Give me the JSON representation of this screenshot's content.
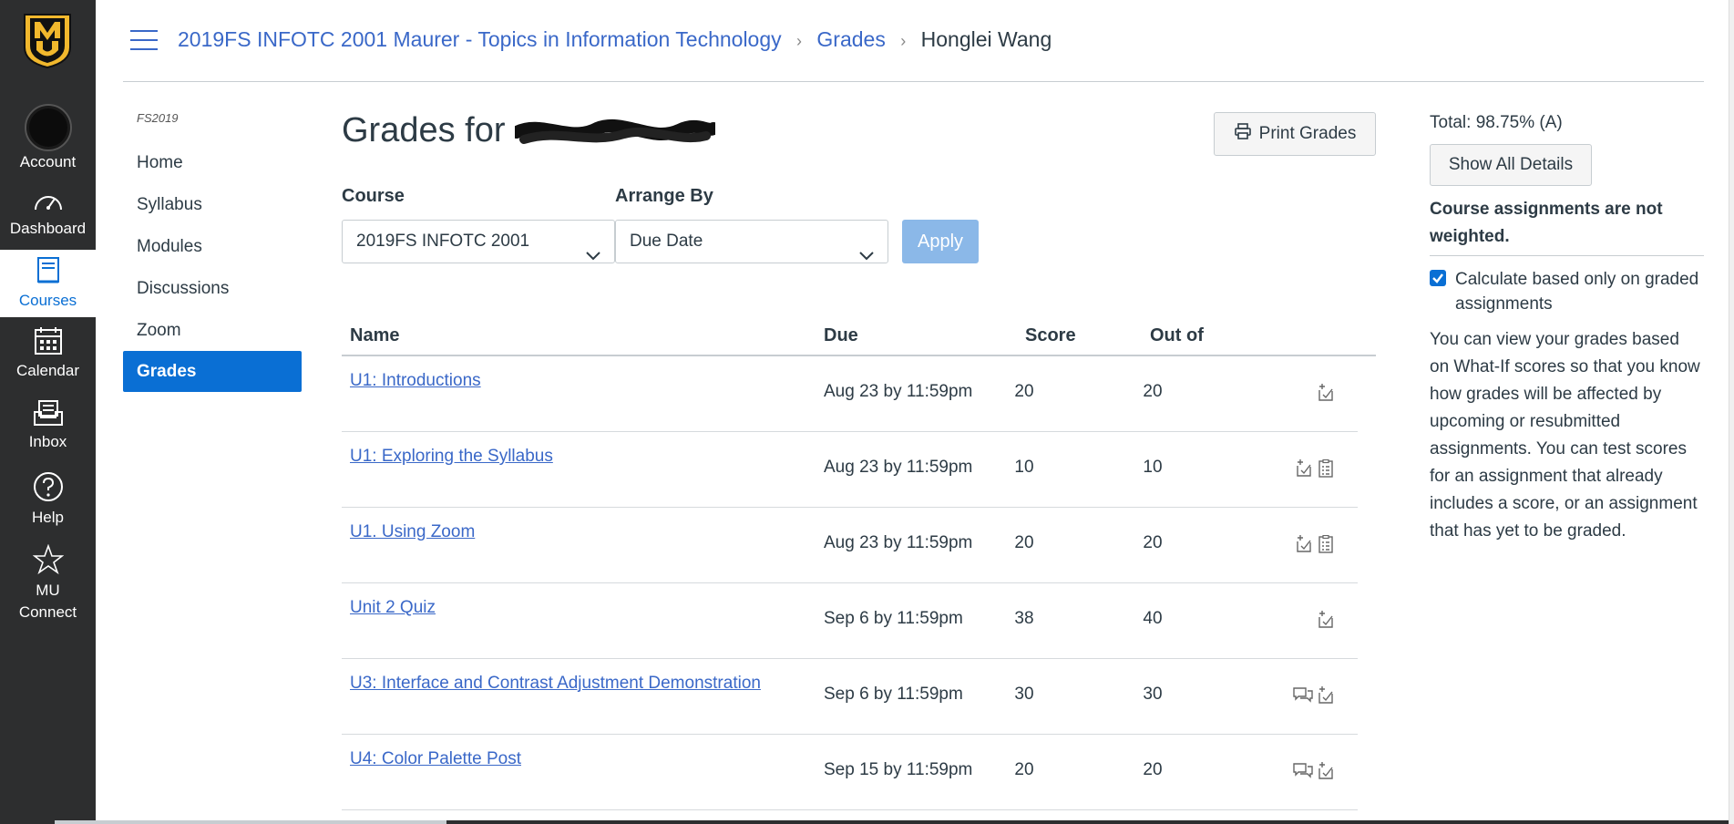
{
  "global_nav": {
    "items": [
      {
        "label": "Account",
        "icon": "avatar"
      },
      {
        "label": "Dashboard",
        "icon": "dashboard-icon"
      },
      {
        "label": "Courses",
        "icon": "courses-icon",
        "active": true
      },
      {
        "label": "Calendar",
        "icon": "calendar-icon"
      },
      {
        "label": "Inbox",
        "icon": "inbox-icon"
      },
      {
        "label": "Help",
        "icon": "help-icon"
      },
      {
        "label": "MU Connect",
        "icon": "star-icon"
      }
    ],
    "logo": "MU"
  },
  "breadcrumb": {
    "course": "2019FS INFOTC 2001 Maurer - Topics in Information Technology",
    "section": "Grades",
    "current": "Honglei Wang"
  },
  "course_nav": {
    "term": "FS2019",
    "items": [
      "Home",
      "Syllabus",
      "Modules",
      "Discussions",
      "Zoom",
      "Grades"
    ],
    "active": "Grades"
  },
  "main": {
    "title_prefix": "Grades for",
    "print_label": "Print Grades",
    "course_label": "Course",
    "course_value": "2019FS INFOTC 2001",
    "arrange_label": "Arrange By",
    "arrange_value": "Due Date",
    "apply_label": "Apply",
    "columns": {
      "name": "Name",
      "due": "Due",
      "score": "Score",
      "outof": "Out of"
    },
    "rows": [
      {
        "name": "U1: Introductions",
        "due": "Aug 23 by 11:59pm",
        "score": "20",
        "outof": "20",
        "icons": [
          "whatif-icon"
        ]
      },
      {
        "name": "U1: Exploring the Syllabus",
        "due": "Aug 23 by 11:59pm",
        "score": "10",
        "outof": "10",
        "icons": [
          "whatif-icon",
          "rubric-icon"
        ]
      },
      {
        "name": "U1. Using Zoom",
        "due": "Aug 23 by 11:59pm",
        "score": "20",
        "outof": "20",
        "icons": [
          "whatif-icon",
          "rubric-icon"
        ]
      },
      {
        "name": "Unit 2 Quiz",
        "due": "Sep 6 by 11:59pm",
        "score": "38",
        "outof": "40",
        "icons": [
          "whatif-icon"
        ]
      },
      {
        "name": "U3: Interface and Contrast Adjustment Demonstration",
        "due": "Sep 6 by 11:59pm",
        "score": "30",
        "outof": "30",
        "icons": [
          "comment-icon",
          "whatif-icon"
        ]
      },
      {
        "name": "U4: Color Palette Post",
        "due": "Sep 15 by 11:59pm",
        "score": "20",
        "outof": "20",
        "icons": [
          "comment-icon",
          "whatif-icon"
        ]
      }
    ]
  },
  "sidebar": {
    "total": "Total: 98.75% (A)",
    "show_details": "Show All Details",
    "weighting": "Course assignments are not weighted.",
    "checkbox_label": "Calculate based only on graded assignments",
    "checkbox_checked": true,
    "info": "You can view your grades based on What-If scores so that you know how grades will be affected by upcoming or resubmitted assignments. You can test scores for an assignment that already includes a score, or an assignment that has yet to be graded."
  },
  "colors": {
    "nav_bg": "#2d2e2f",
    "link": "#3a68c8",
    "accent": "#0a6fd4",
    "logo_gold": "#f1b82d"
  }
}
